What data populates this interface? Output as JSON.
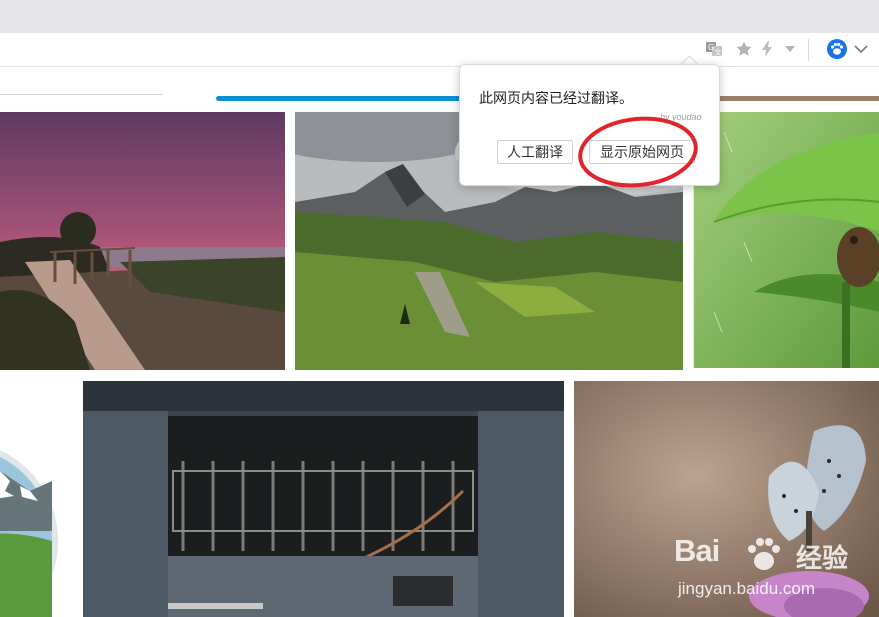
{
  "toolbar": {
    "icons": [
      "translate-icon",
      "star-icon",
      "bolt-icon",
      "dropdown-caret-icon",
      "paw-icon",
      "chevron-down-icon"
    ],
    "accent_color": "#1a73e8"
  },
  "popup": {
    "message": "此网页内容已经过翻译。",
    "provider": "by youdao",
    "human_translate_label": "人工翻译",
    "show_original_label": "显示原始网页",
    "highlight_color": "#e0242b"
  },
  "gallery": {
    "images": [
      "sunset-boardwalk",
      "mountain-landscape",
      "green-leaf-rain",
      "snowy-mountain-circle",
      "engine-machinery",
      "butterfly-on-flower"
    ]
  },
  "watermark": {
    "logo_text": "Bai",
    "logo_suffix": "经验",
    "url": "jingyan.baidu.com"
  }
}
